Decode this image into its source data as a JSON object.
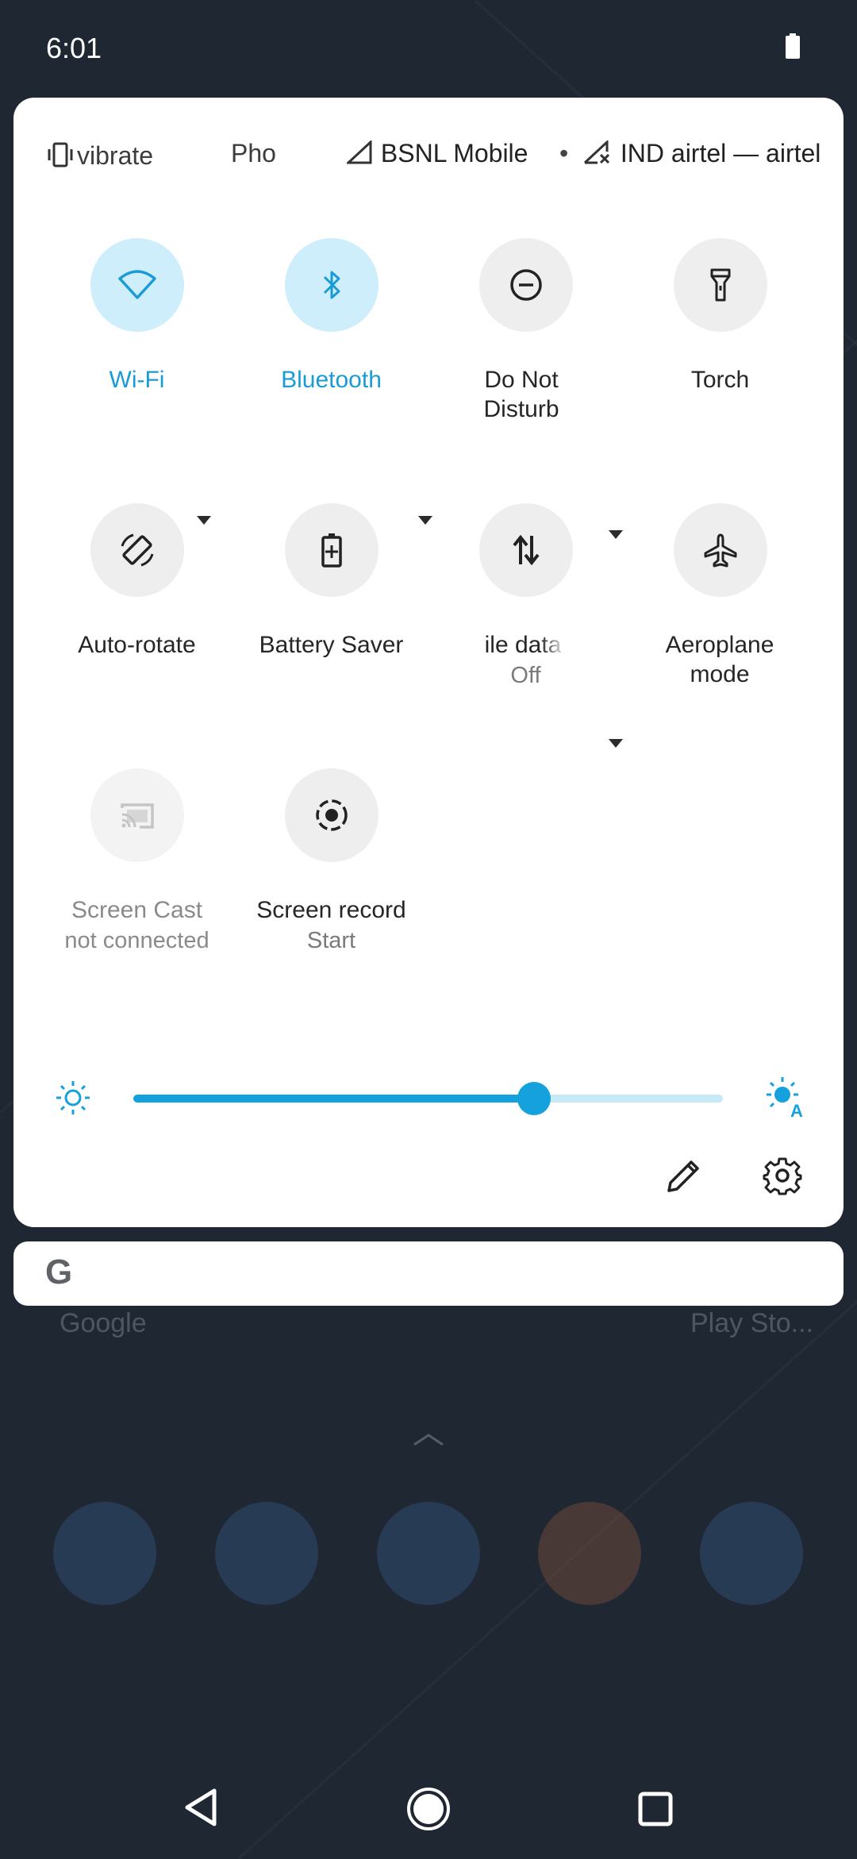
{
  "status_bar": {
    "time": "6:01"
  },
  "quick_settings": {
    "header": {
      "vibrate": "vibrate",
      "phone": "Pho",
      "carrier1": "BSNL Mobile",
      "separator": "•",
      "carrier2": "IND airtel — airtel"
    },
    "tiles": [
      {
        "label": "Wi-Fi",
        "icon": "wifi-icon",
        "state": "on"
      },
      {
        "label": "Bluetooth",
        "icon": "bluetooth-icon",
        "state": "on"
      },
      {
        "label": "Do Not Disturb",
        "icon": "do-not-disturb-icon",
        "state": "off"
      },
      {
        "label": "Torch",
        "icon": "torch-icon",
        "state": "off"
      },
      {
        "label": "Auto-rotate",
        "icon": "auto-rotate-icon",
        "state": "off"
      },
      {
        "label": "Battery Saver",
        "icon": "battery-saver-icon",
        "state": "off"
      },
      {
        "label": "ile data",
        "sub": "Off",
        "icon": "mobile-data-icon",
        "state": "off"
      },
      {
        "label": "Aeroplane mode",
        "icon": "airplane-icon",
        "state": "off"
      },
      {
        "label": "Screen Cast",
        "sub": "not connected",
        "icon": "cast-icon",
        "state": "unavailable"
      },
      {
        "label": "Screen record",
        "sub": "Start",
        "icon": "screen-record-icon",
        "state": "off"
      }
    ],
    "brightness": {
      "level": 0.68
    },
    "accent": "#15a1de"
  },
  "home": {
    "search_logo": "G",
    "app_labels": [
      "Google",
      "Play Sto..."
    ]
  }
}
